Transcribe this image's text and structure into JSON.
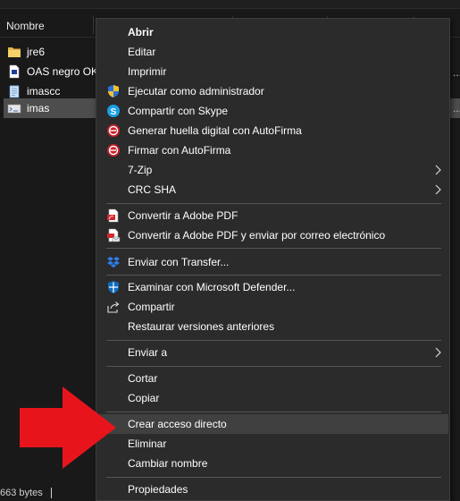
{
  "explorer": {
    "column_header": {
      "name_label": "Nombre"
    },
    "files": [
      {
        "name": "jre6",
        "icon": "folder-icon",
        "selected": false
      },
      {
        "name": "OAS negro OK",
        "icon": "document-icon",
        "selected": false
      },
      {
        "name": "imascc",
        "icon": "notepad-file-icon",
        "selected": false
      },
      {
        "name": "imas",
        "icon": "script-file-icon",
        "selected": true
      }
    ],
    "overflow_dots": "...",
    "status_text": "663 bytes"
  },
  "context_menu": {
    "items": [
      {
        "label": "Abrir",
        "bold": true,
        "icon": "",
        "submenu": false
      },
      {
        "label": "Editar",
        "bold": false,
        "icon": "",
        "submenu": false
      },
      {
        "label": "Imprimir",
        "bold": false,
        "icon": "",
        "submenu": false
      },
      {
        "label": "Ejecutar como administrador",
        "bold": false,
        "icon": "uac-shield-icon",
        "submenu": false
      },
      {
        "label": "Compartir con Skype",
        "bold": false,
        "icon": "skype-icon",
        "submenu": false
      },
      {
        "label": "Generar huella digital con AutoFirma",
        "bold": false,
        "icon": "autofirma-icon",
        "submenu": false
      },
      {
        "label": "Firmar con AutoFirma",
        "bold": false,
        "icon": "autofirma-icon",
        "submenu": false
      },
      {
        "label": "7-Zip",
        "bold": false,
        "icon": "",
        "submenu": true
      },
      {
        "label": "CRC SHA",
        "bold": false,
        "icon": "",
        "submenu": true
      },
      {
        "label": "Convertir a Adobe PDF",
        "bold": false,
        "icon": "adobe-pdf-icon",
        "submenu": false
      },
      {
        "label": "Convertir a Adobe PDF y enviar por correo electrónico",
        "bold": false,
        "icon": "adobe-pdf-mail-icon",
        "submenu": false
      },
      {
        "label": "Enviar con Transfer...",
        "bold": false,
        "icon": "dropbox-icon",
        "submenu": false
      },
      {
        "label": "Examinar con Microsoft Defender...",
        "bold": false,
        "icon": "defender-icon",
        "submenu": false
      },
      {
        "label": "Compartir",
        "bold": false,
        "icon": "share-icon",
        "submenu": false
      },
      {
        "label": "Restaurar versiones anteriores",
        "bold": false,
        "icon": "",
        "submenu": false
      },
      {
        "label": "Enviar a",
        "bold": false,
        "icon": "",
        "submenu": true
      },
      {
        "label": "Cortar",
        "bold": false,
        "icon": "",
        "submenu": false
      },
      {
        "label": "Copiar",
        "bold": false,
        "icon": "",
        "submenu": false
      },
      {
        "label": "Crear acceso directo",
        "bold": false,
        "icon": "",
        "submenu": false,
        "highlighted": true
      },
      {
        "label": "Eliminar",
        "bold": false,
        "icon": "",
        "submenu": false
      },
      {
        "label": "Cambiar nombre",
        "bold": false,
        "icon": "",
        "submenu": false
      },
      {
        "label": "Propiedades",
        "bold": false,
        "icon": "",
        "submenu": false
      }
    ]
  },
  "colors": {
    "background": "#191919",
    "menu_background": "#2b2b2b",
    "menu_highlight": "#404040",
    "selected_row": "#4d4d4d",
    "annotation_arrow": "#e8141c"
  },
  "annotation": {
    "icon": "red-arrow-icon"
  }
}
